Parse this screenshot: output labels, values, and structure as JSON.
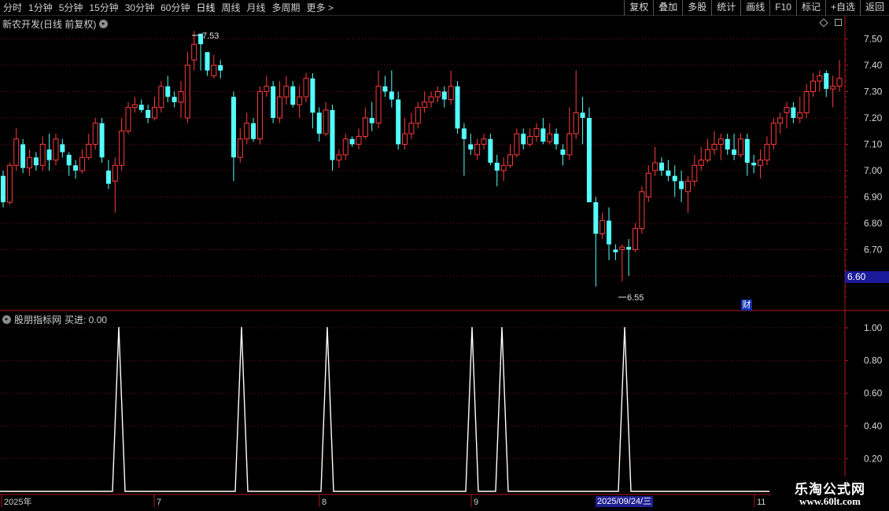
{
  "toolbar": {
    "periods": [
      "分时",
      "1分钟",
      "5分钟",
      "15分钟",
      "30分钟",
      "60分钟",
      "日线",
      "周线",
      "月线",
      "多周期",
      "更多 >"
    ],
    "active_period": "日线",
    "right_buttons": [
      "复权",
      "叠加",
      "多股",
      "统计",
      "画线",
      "F10",
      "标记",
      "+自选",
      "返回"
    ]
  },
  "main_chart": {
    "title": "新农开发(日线 前复权)",
    "high_label": "7.53",
    "low_label": "6.55",
    "current_price_tag": "6.60",
    "finance_icon_label": "财"
  },
  "indicator": {
    "title": "股朋指标网",
    "buy_label": "买进: 0.00"
  },
  "x_axis": {
    "labels": [
      "2025年",
      "7",
      "8",
      "9",
      "2025/09/24/三",
      "11"
    ]
  },
  "watermark": {
    "line1": "乐淘公式网",
    "line2": "www.60lt.com"
  },
  "colors": {
    "up": "#ff3c3c",
    "down": "#54ffff",
    "axis": "#b01818",
    "grid": "#7a1010",
    "signal": "#ffffff",
    "highlight_bg": "#202090"
  },
  "chart_data": [
    {
      "type": "candlestick",
      "title": "新农开发(日线 前复权)",
      "y_ticks": [
        6.6,
        6.7,
        6.8,
        6.9,
        7.0,
        7.1,
        7.2,
        7.3,
        7.4,
        7.5
      ],
      "ylim": [
        6.57,
        7.57
      ],
      "candles": [
        [
          6.98,
          6.88,
          7.0,
          6.86
        ],
        [
          6.88,
          7.02,
          7.03,
          6.87
        ],
        [
          7.02,
          7.12,
          7.16,
          7.0
        ],
        [
          7.1,
          7.01,
          7.12,
          6.99
        ],
        [
          7.01,
          7.05,
          7.08,
          6.98
        ],
        [
          7.05,
          7.02,
          7.07,
          7.0
        ],
        [
          7.02,
          7.1,
          7.13,
          7.0
        ],
        [
          7.08,
          7.04,
          7.14,
          7.0
        ],
        [
          7.04,
          7.12,
          7.14,
          7.02
        ],
        [
          7.1,
          7.07,
          7.12,
          7.05
        ],
        [
          7.06,
          7.02,
          7.07,
          6.98
        ],
        [
          7.02,
          7.0,
          7.04,
          6.97
        ],
        [
          7.0,
          7.05,
          7.08,
          6.99
        ],
        [
          7.05,
          7.1,
          7.14,
          7.04
        ],
        [
          7.1,
          7.18,
          7.2,
          7.08
        ],
        [
          7.18,
          7.05,
          7.2,
          7.03
        ],
        [
          7.0,
          6.95,
          7.04,
          6.93
        ],
        [
          6.96,
          7.02,
          7.05,
          6.84
        ],
        [
          7.02,
          7.15,
          7.2,
          7.0
        ],
        [
          7.15,
          7.24,
          7.26,
          7.14
        ],
        [
          7.24,
          7.25,
          7.28,
          7.22
        ],
        [
          7.25,
          7.23,
          7.27,
          7.22
        ],
        [
          7.23,
          7.2,
          7.25,
          7.18
        ],
        [
          7.2,
          7.24,
          7.28,
          7.19
        ],
        [
          7.24,
          7.32,
          7.34,
          7.22
        ],
        [
          7.32,
          7.28,
          7.36,
          7.26
        ],
        [
          7.28,
          7.26,
          7.3,
          7.24
        ],
        [
          7.26,
          7.3,
          7.34,
          7.2
        ],
        [
          7.2,
          7.4,
          7.45,
          7.18
        ],
        [
          7.42,
          7.48,
          7.53,
          7.38
        ],
        [
          7.52,
          7.48,
          7.5,
          7.38
        ],
        [
          7.45,
          7.38,
          7.42,
          7.36
        ],
        [
          7.36,
          7.4,
          7.44,
          7.35
        ],
        [
          7.4,
          7.38,
          7.42,
          7.35
        ],
        [
          null,
          null,
          null,
          null
        ],
        [
          7.28,
          7.05,
          7.3,
          6.96
        ],
        [
          7.05,
          7.12,
          7.16,
          7.03
        ],
        [
          7.12,
          7.18,
          7.22,
          7.1
        ],
        [
          7.18,
          7.12,
          7.2,
          7.11
        ],
        [
          7.12,
          7.3,
          7.32,
          7.1
        ],
        [
          7.3,
          7.32,
          7.36,
          7.28
        ],
        [
          7.32,
          7.2,
          7.34,
          7.18
        ],
        [
          7.2,
          7.28,
          7.34,
          7.18
        ],
        [
          7.28,
          7.32,
          7.36,
          7.25
        ],
        [
          7.32,
          7.25,
          7.34,
          7.24
        ],
        [
          7.25,
          7.28,
          7.32,
          7.2
        ],
        [
          7.28,
          7.35,
          7.37,
          7.26
        ],
        [
          7.35,
          7.22,
          7.37,
          7.16
        ],
        [
          7.22,
          7.14,
          7.24,
          7.11
        ],
        [
          7.14,
          7.23,
          7.26,
          7.13
        ],
        [
          7.23,
          7.04,
          7.25,
          7.0
        ],
        [
          7.04,
          7.06,
          7.08,
          7.01
        ],
        [
          7.06,
          7.12,
          7.14,
          7.04
        ],
        [
          7.12,
          7.1,
          7.13,
          7.09
        ],
        [
          7.1,
          7.13,
          7.16,
          7.08
        ],
        [
          7.13,
          7.2,
          7.24,
          7.12
        ],
        [
          7.2,
          7.18,
          7.26,
          7.15
        ],
        [
          7.18,
          7.32,
          7.38,
          7.16
        ],
        [
          7.32,
          7.3,
          7.36,
          7.28
        ],
        [
          7.3,
          7.27,
          7.38,
          7.24
        ],
        [
          7.27,
          7.1,
          7.3,
          7.08
        ],
        [
          7.1,
          7.14,
          7.2,
          7.08
        ],
        [
          7.14,
          7.18,
          7.22,
          7.12
        ],
        [
          7.18,
          7.24,
          7.26,
          7.16
        ],
        [
          7.24,
          7.26,
          7.3,
          7.22
        ],
        [
          7.26,
          7.28,
          7.3,
          7.24
        ],
        [
          7.28,
          7.3,
          7.32,
          7.26
        ],
        [
          7.3,
          7.27,
          7.32,
          7.24
        ],
        [
          7.27,
          7.32,
          7.38,
          7.25
        ],
        [
          7.32,
          7.16,
          7.34,
          7.14
        ],
        [
          7.16,
          7.12,
          7.18,
          6.98
        ],
        [
          7.1,
          7.08,
          7.14,
          7.06
        ],
        [
          7.06,
          7.1,
          7.12,
          7.04
        ],
        [
          7.1,
          7.12,
          7.14,
          7.08
        ],
        [
          7.12,
          7.03,
          7.14,
          7.02
        ],
        [
          7.03,
          7.0,
          7.06,
          6.94
        ],
        [
          7.0,
          7.02,
          7.05,
          6.96
        ],
        [
          7.02,
          7.06,
          7.1,
          7.01
        ],
        [
          7.06,
          7.14,
          7.16,
          7.05
        ],
        [
          7.14,
          7.1,
          7.16,
          7.08
        ],
        [
          7.1,
          7.13,
          7.16,
          7.09
        ],
        [
          7.13,
          7.16,
          7.18,
          7.11
        ],
        [
          7.16,
          7.11,
          7.2,
          7.1
        ],
        [
          7.11,
          7.14,
          7.18,
          7.1
        ],
        [
          7.14,
          7.1,
          7.16,
          7.08
        ],
        [
          7.08,
          7.06,
          7.1,
          7.02
        ],
        [
          7.06,
          7.14,
          7.24,
          7.04
        ],
        [
          7.14,
          7.22,
          7.38,
          7.12
        ],
        [
          7.22,
          7.2,
          7.28,
          7.1
        ],
        [
          7.2,
          6.88,
          7.24,
          6.88
        ],
        [
          6.88,
          6.76,
          6.9,
          6.56
        ],
        [
          6.76,
          6.81,
          6.84,
          6.74
        ],
        [
          6.81,
          6.72,
          6.86,
          6.66
        ],
        [
          6.7,
          6.69,
          6.72,
          6.66
        ],
        [
          6.7,
          6.71,
          6.72,
          6.58
        ],
        [
          6.71,
          6.7,
          6.74,
          6.6
        ],
        [
          6.7,
          6.78,
          6.8,
          6.69
        ],
        [
          6.78,
          6.92,
          6.94,
          6.76
        ],
        [
          6.9,
          6.99,
          7.02,
          6.88
        ],
        [
          7.0,
          7.03,
          7.09,
          6.98
        ],
        [
          7.03,
          7.0,
          7.05,
          6.98
        ],
        [
          7.0,
          6.98,
          7.04,
          6.96
        ],
        [
          6.98,
          6.96,
          7.02,
          6.9
        ],
        [
          6.96,
          6.93,
          7.0,
          6.88
        ],
        [
          6.92,
          6.96,
          6.98,
          6.84
        ],
        [
          6.96,
          7.02,
          7.06,
          6.94
        ],
        [
          7.02,
          7.04,
          7.09,
          7.0
        ],
        [
          7.04,
          7.08,
          7.12,
          7.03
        ],
        [
          7.08,
          7.1,
          7.15,
          7.06
        ],
        [
          7.1,
          7.12,
          7.14,
          7.04
        ],
        [
          7.12,
          7.08,
          7.14,
          7.06
        ],
        [
          7.08,
          7.06,
          7.14,
          7.04
        ],
        [
          7.06,
          7.12,
          7.14,
          7.05
        ],
        [
          7.12,
          7.03,
          7.14,
          6.98
        ],
        [
          7.03,
          7.02,
          7.06,
          6.99
        ],
        [
          7.02,
          7.04,
          7.08,
          6.97
        ],
        [
          7.04,
          7.1,
          7.13,
          7.02
        ],
        [
          7.1,
          7.18,
          7.2,
          7.08
        ],
        [
          7.18,
          7.2,
          7.22,
          7.14
        ],
        [
          7.22,
          7.24,
          7.26,
          7.16
        ],
        [
          7.24,
          7.2,
          7.26,
          7.18
        ],
        [
          7.2,
          7.22,
          7.28,
          7.18
        ],
        [
          7.22,
          7.3,
          7.33,
          7.2
        ],
        [
          7.3,
          7.34,
          7.37,
          7.28
        ],
        [
          7.34,
          7.36,
          7.38,
          7.3
        ],
        [
          7.37,
          7.31,
          7.38,
          7.28
        ],
        [
          7.31,
          7.32,
          7.36,
          7.24
        ],
        [
          7.32,
          7.35,
          7.42,
          7.3
        ]
      ]
    },
    {
      "type": "line",
      "title": "股朋指标网",
      "series": [
        {
          "name": "买进",
          "values": "signal pulses 0→1→0"
        }
      ],
      "y_ticks": [
        0.2,
        0.4,
        0.6,
        0.8,
        1.0
      ],
      "ylim": [
        -0.12,
        1.03
      ],
      "spikes_x": [
        151,
        307,
        416,
        600,
        638,
        794
      ],
      "baseline": 0.0
    }
  ]
}
